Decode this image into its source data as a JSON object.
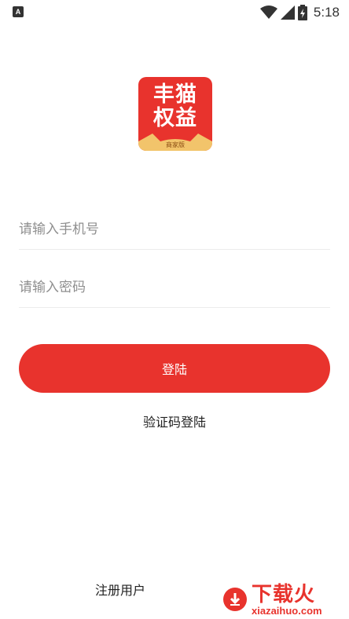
{
  "status_bar": {
    "left_icon_label": "A",
    "time": "5:18",
    "icons": [
      "wifi-icon",
      "signal-icon",
      "battery-charging-icon"
    ]
  },
  "logo": {
    "line1": "丰猫",
    "line2": "权益",
    "badge": "商家版",
    "brand_color": "#e8332d"
  },
  "form": {
    "phone_placeholder": "请输入手机号",
    "phone_value": "",
    "password_placeholder": "请输入密码",
    "password_value": ""
  },
  "login_button_label": "登陆",
  "sms_login_label": "验证码登陆",
  "register_label": "注册用户",
  "watermark": {
    "title": "下载火",
    "url": "xiazaihuo.com"
  }
}
